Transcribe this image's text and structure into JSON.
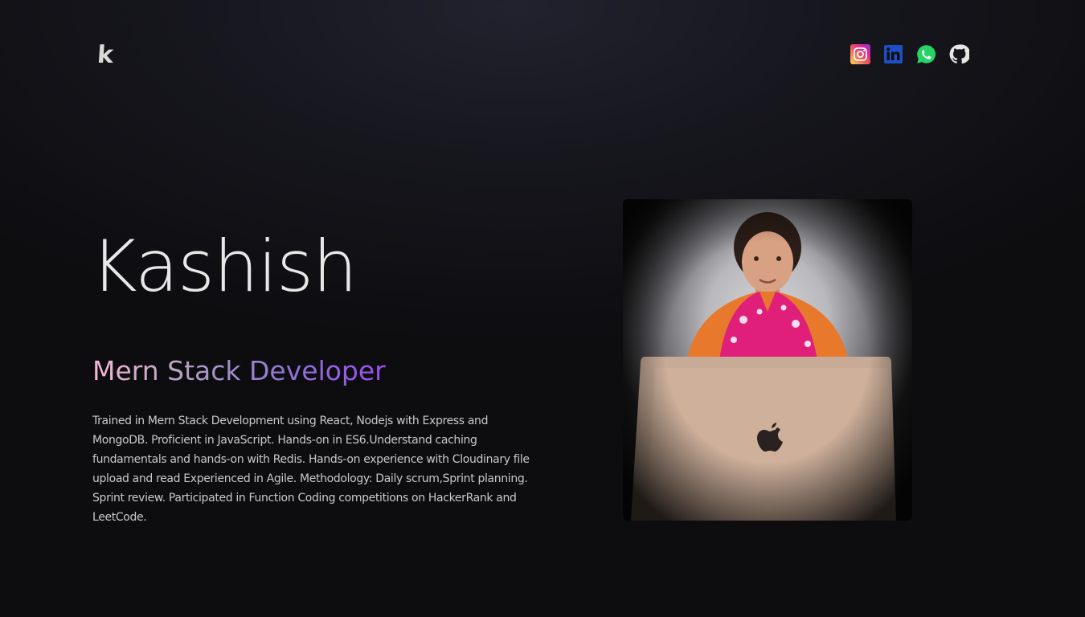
{
  "header": {
    "logo_text": "k",
    "socials": [
      {
        "name": "instagram",
        "icon": "instagram-icon",
        "color": "#d6249f"
      },
      {
        "name": "linkedin",
        "icon": "linkedin-icon",
        "color": "#1d4fc4"
      },
      {
        "name": "whatsapp",
        "icon": "whatsapp-icon",
        "color": "#25d366"
      },
      {
        "name": "github",
        "icon": "github-icon",
        "color": "#e6e6e6"
      }
    ]
  },
  "hero": {
    "name": "Kashish",
    "title": "Mern Stack Developer",
    "description": "Trained in Mern Stack Development using React, Nodejs with Express and MongoDB. Proficient in JavaScript. Hands-on in ES6.Understand caching fundamentals and hands-on with Redis. Hands-on experience with Cloudinary file upload and read Experienced in Agile. Methodology: Daily scrum,Sprint planning. Sprint review. Participated in Function Coding competitions on HackerRank and LeetCode."
  },
  "colors": {
    "background": "#0d0d10",
    "title_gradient": [
      "#f7b6d8",
      "#b4a2c4",
      "#8f76d4",
      "#9a4ef0"
    ]
  }
}
